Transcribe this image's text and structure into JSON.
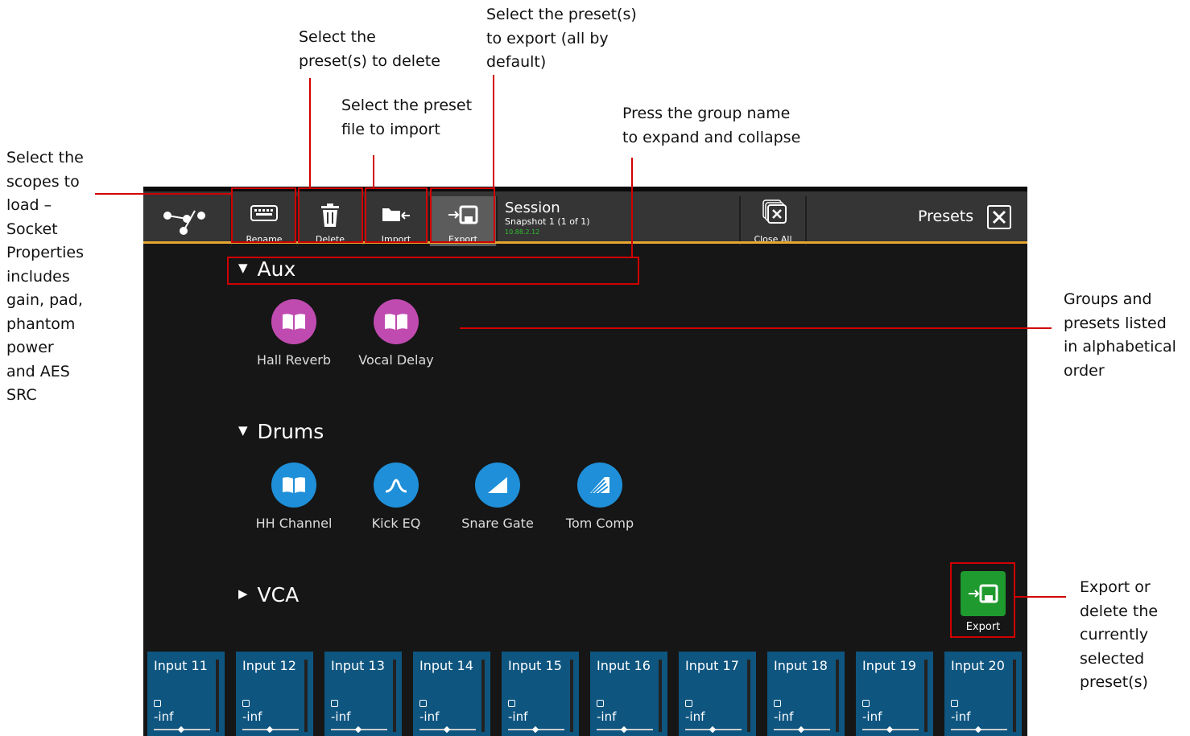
{
  "annotations": {
    "scopes": "Select the\nscopes to\nload –\nSocket\nProperties\nincludes\ngain, pad,\nphantom\npower\nand AES\nSRC",
    "delete": "Select the\npreset(s) to delete",
    "import": "Select the preset\nfile to import",
    "export": "Select the preset(s)\nto export (all by\ndefault)",
    "group": "Press the group name\nto expand and collapse",
    "list": "Groups and\npresets listed\nin alphabetical\norder",
    "export_delete": "Export or\ndelete the\ncurrently\nselected\npreset(s)"
  },
  "toolbar": {
    "rename_label": "Rename",
    "delete_label": "Delete",
    "import_label": "Import",
    "export_label": "Export",
    "session_title": "Session",
    "session_snapshot": "Snapshot 1 (1 of 1)",
    "session_ip": "10.88.2.12",
    "close_all_label": "Close All",
    "panel_title": "Presets"
  },
  "groups": [
    {
      "name": "Aux",
      "expanded": true,
      "presets": [
        {
          "label": "Hall Reverb",
          "icon": "book-icon",
          "color": "#c04bb0"
        },
        {
          "label": "Vocal Delay",
          "icon": "book-icon",
          "color": "#c04bb0"
        }
      ]
    },
    {
      "name": "Drums",
      "expanded": true,
      "presets": [
        {
          "label": "HH Channel",
          "icon": "book-icon",
          "color": "#1e8fd8"
        },
        {
          "label": "Kick EQ",
          "icon": "eq-curve-icon",
          "color": "#1e8fd8"
        },
        {
          "label": "Snare Gate",
          "icon": "gate-icon",
          "color": "#1e8fd8"
        },
        {
          "label": "Tom Comp",
          "icon": "compressor-icon",
          "color": "#1e8fd8"
        }
      ]
    },
    {
      "name": "VCA",
      "expanded": false,
      "presets": []
    }
  ],
  "export_button": {
    "label": "Export",
    "color": "#1f9a2e"
  },
  "strips": [
    {
      "name": "Input 11",
      "level": "-inf"
    },
    {
      "name": "Input 12",
      "level": "-inf"
    },
    {
      "name": "Input 13",
      "level": "-inf"
    },
    {
      "name": "Input 14",
      "level": "-inf"
    },
    {
      "name": "Input 15",
      "level": "-inf"
    },
    {
      "name": "Input 16",
      "level": "-inf"
    },
    {
      "name": "Input 17",
      "level": "-inf"
    },
    {
      "name": "Input 18",
      "level": "-inf"
    },
    {
      "name": "Input 19",
      "level": "-inf"
    },
    {
      "name": "Input 20",
      "level": "-inf"
    }
  ],
  "colors": {
    "accent": "#e7a530",
    "annotation": "#d20000",
    "strip": "#0e5580"
  }
}
